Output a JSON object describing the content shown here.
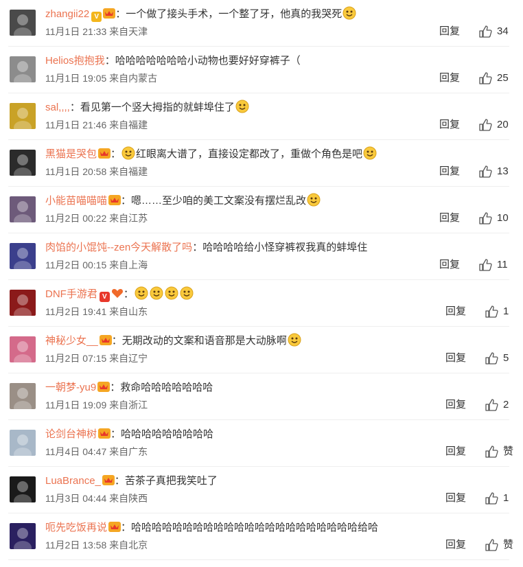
{
  "comments": [
    {
      "name": "zhangii22",
      "text": "一个做了接头手术，一个整了牙，他真的我哭死",
      "emojis_after": 1,
      "date": "11月1日 21:33",
      "location": "来自天津",
      "reply": "回复",
      "likes": "34",
      "badges": [
        "gold-v",
        "vip"
      ],
      "avatar_color": "#4a4a4a"
    },
    {
      "name": "Helios抱抱我",
      "text": "哈哈哈哈哈哈哈小动物也要好好穿裤子（",
      "emojis_after": 0,
      "date": "11月1日 19:05",
      "location": "来自内蒙古",
      "reply": "回复",
      "likes": "25",
      "badges": [],
      "avatar_color": "#8c8c8c"
    },
    {
      "name": "sal,,,,",
      "text": "看见第一个竖大拇指的就蚌埠住了",
      "emojis_after": 1,
      "date": "11月1日 21:46",
      "location": "来自福建",
      "reply": "回复",
      "likes": "20",
      "badges": [],
      "avatar_color": "#c9a227"
    },
    {
      "name": "黑猫是哭包",
      "text": "红眼离大谱了，直接设定都改了，重做个角色是吧",
      "emojis_before": 1,
      "emojis_after": 1,
      "date": "11月1日 20:58",
      "location": "来自福建",
      "reply": "回复",
      "likes": "13",
      "badges": [
        "vip"
      ],
      "avatar_color": "#2b2b2b"
    },
    {
      "name": "小能苗喵喵喵",
      "text": "嗯……至少咱的美工文案没有摆烂乱改",
      "emojis_after": 1,
      "date": "11月2日 00:22",
      "location": "来自江苏",
      "reply": "回复",
      "likes": "10",
      "badges": [
        "vip"
      ],
      "avatar_color": "#6d5a7a"
    },
    {
      "name": "肉馅的小馄饨--zen今天解散了吗",
      "text": "哈哈哈哈给小怪穿裤衩我真的蚌埠住",
      "emojis_after": 0,
      "date": "11月2日 00:15",
      "location": "来自上海",
      "reply": "回复",
      "likes": "11",
      "badges": [],
      "avatar_color": "#3b3f8c"
    },
    {
      "name": "DNF手游君",
      "text": "",
      "emojis_after": 4,
      "date": "11月2日 19:41",
      "location": "来自山东",
      "reply": "回复",
      "likes": "1",
      "badges": [
        "red-v",
        "heart"
      ],
      "avatar_color": "#8b1a1a"
    },
    {
      "name": "神秘少女__",
      "text": "无期改动的文案和语音那是大动脉啊",
      "emojis_after": 1,
      "date": "11月2日 07:15",
      "location": "来自辽宁",
      "reply": "回复",
      "likes": "5",
      "badges": [
        "vip"
      ],
      "avatar_color": "#d46a8a"
    },
    {
      "name": "一朝梦-yu9",
      "text": "救命哈哈哈哈哈哈哈",
      "emojis_after": 0,
      "date": "11月1日 19:09",
      "location": "来自浙江",
      "reply": "回复",
      "likes": "2",
      "badges": [
        "vip"
      ],
      "avatar_color": "#9a8f86"
    },
    {
      "name": "论剑台神树",
      "text": "哈哈哈哈哈哈哈哈哈",
      "emojis_after": 0,
      "date": "11月4日 04:47",
      "location": "来自广东",
      "reply": "回复",
      "likes": "赞",
      "badges": [
        "vip"
      ],
      "avatar_color": "#a8b8c8"
    },
    {
      "name": "LuaBrance_",
      "text": "苦茶子真把我笑吐了",
      "emojis_after": 0,
      "date": "11月3日 04:44",
      "location": "来自陕西",
      "reply": "回复",
      "likes": "1",
      "badges": [
        "vip"
      ],
      "avatar_color": "#1a1a1a"
    },
    {
      "name": "呃先吃饭再说",
      "text": "哈哈哈哈哈哈哈哈哈哈哈哈哈哈哈哈哈哈哈哈哈哈给哈",
      "emojis_after": 0,
      "date": "11月2日 13:58",
      "location": "来自北京",
      "reply": "回复",
      "likes": "赞",
      "badges": [
        "vip"
      ],
      "avatar_color": "#2a2060"
    }
  ]
}
